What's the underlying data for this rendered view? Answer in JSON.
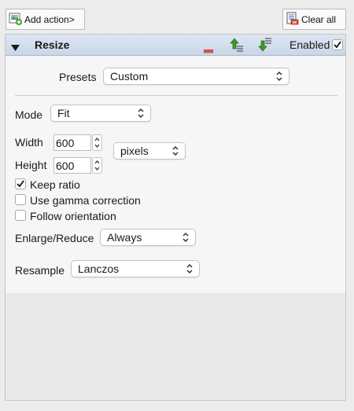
{
  "toolbar": {
    "add_action_label": "Add action>",
    "clear_all_label": "Clear all"
  },
  "action": {
    "title": "Resize",
    "enabled_label": "Enabled",
    "enabled_checked": true
  },
  "form": {
    "presets_label": "Presets",
    "presets_value": "Custom",
    "mode_label": "Mode",
    "mode_value": "Fit",
    "width_label": "Width",
    "width_value": "600",
    "height_label": "Height",
    "height_value": "600",
    "unit_value": "pixels",
    "keep_ratio_label": "Keep ratio",
    "keep_ratio_checked": true,
    "gamma_label": "Use gamma correction",
    "gamma_checked": false,
    "orientation_label": "Follow orientation",
    "orientation_checked": false,
    "enlarge_label": "Enlarge/Reduce",
    "enlarge_value": "Always",
    "resample_label": "Resample",
    "resample_value": "Lanczos"
  },
  "colors": {
    "header_bg": "#d3deed",
    "move_up_green": "#3a9a2a",
    "remove_red": "#d9534f"
  },
  "icons": {
    "add_action": "add-image-icon",
    "clear_all": "clear-list-icon",
    "collapse": "triangle-down-icon",
    "remove": "minus-icon",
    "move_up": "arrow-up-icon",
    "move_down": "arrow-down-icon"
  }
}
